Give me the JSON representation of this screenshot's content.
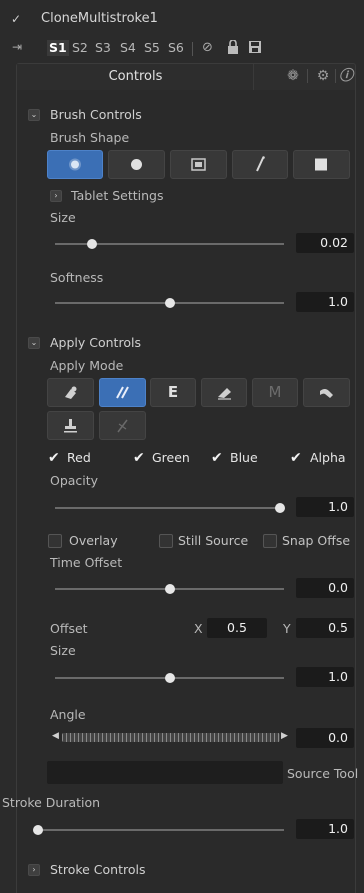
{
  "tool": {
    "name": "CloneMultistroke1",
    "slots": [
      "S1",
      "S2",
      "S3",
      "S4",
      "S5",
      "S6"
    ]
  },
  "tabs": {
    "controls_label": "Controls"
  },
  "brush_controls": {
    "header": "Brush Controls",
    "shape_label": "Brush Shape",
    "shapes": [
      "soft-brush",
      "circle-brush",
      "image-brush",
      "single-pixel-brush",
      "square-brush"
    ],
    "tablet_settings": "Tablet Settings",
    "size_label": "Size",
    "size_value": "0.02",
    "size_level": 0.15,
    "softness_label": "Softness",
    "softness_value": "1.0",
    "softness_level": 0.5
  },
  "apply_controls": {
    "header": "Apply Controls",
    "mode_label": "Apply Mode",
    "modes": [
      "color",
      "clone",
      "emboss",
      "erase",
      "merge",
      "smear",
      "stamp",
      "wire"
    ],
    "channels": [
      {
        "label": "Red",
        "checked": true
      },
      {
        "label": "Green",
        "checked": true
      },
      {
        "label": "Blue",
        "checked": true
      },
      {
        "label": "Alpha",
        "checked": true
      }
    ],
    "opacity_label": "Opacity",
    "opacity_value": "1.0",
    "opacity_level": 1.0,
    "options": [
      {
        "label": "Overlay",
        "checked": false
      },
      {
        "label": "Still Source",
        "checked": false
      },
      {
        "label": "Snap Offse",
        "checked": false
      }
    ],
    "time_offset_label": "Time Offset",
    "time_offset_value": "0.0",
    "time_offset_level": 0.5,
    "offset_label": "Offset",
    "offset_x_label": "X",
    "offset_x_value": "0.5",
    "offset_y_label": "Y",
    "offset_y_value": "0.5",
    "size_label": "Size",
    "size_value": "1.0",
    "size_level": 0.5,
    "angle_label": "Angle",
    "angle_value": "0.0",
    "source_tool_value": "",
    "source_tool_label": "Source Tool"
  },
  "stroke": {
    "duration_label": "Stroke Duration",
    "duration_value": "1.0",
    "duration_level": 0.0,
    "controls_header": "Stroke Controls"
  },
  "colors": {
    "active_button": "#3b6fb5",
    "background": "#2b2b2b"
  }
}
